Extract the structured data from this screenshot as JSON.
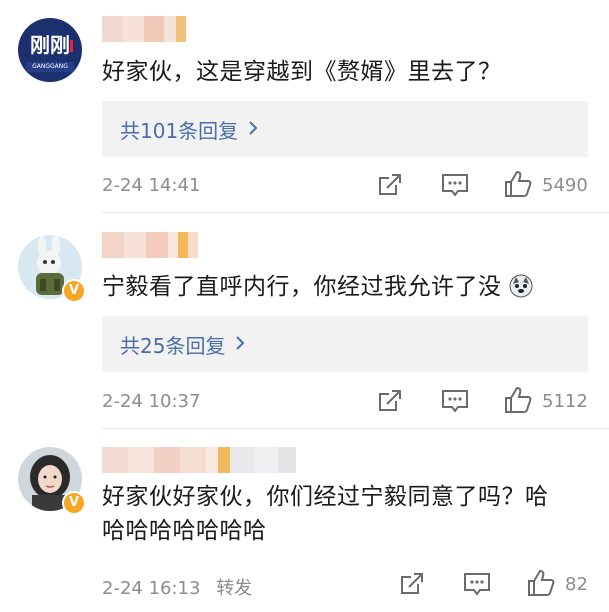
{
  "comments": [
    {
      "text": "好家伙，这是穿越到《赘婿》里去了？",
      "replies_label": "共101条回复",
      "time": "2-24 14:41",
      "likes": "5490"
    },
    {
      "text": "宁毅看了直呼内行，你经过我允许了没",
      "emoji_name": "husky-emoji",
      "replies_label": "共25条回复",
      "time": "2-24 10:37",
      "likes": "5112"
    },
    {
      "text_line1": "好家伙好家伙，你们经过宁毅同意了吗？哈",
      "text_line2": "哈哈哈哈哈哈哈",
      "time": "2-24 16:13",
      "forward_label": "转发",
      "likes": "82"
    }
  ],
  "avatar1_text": {
    "line1": "刚刚",
    "line2": "GANGGANG"
  },
  "badge_label": "V",
  "icons": [
    "share-icon",
    "comment-icon",
    "like-icon",
    "chevron-right-icon"
  ],
  "colors": {
    "link": "#4a6ea8",
    "muted": "#8c8c8c",
    "reply_bg": "#f2f2f2",
    "badge": "#f6a623"
  }
}
